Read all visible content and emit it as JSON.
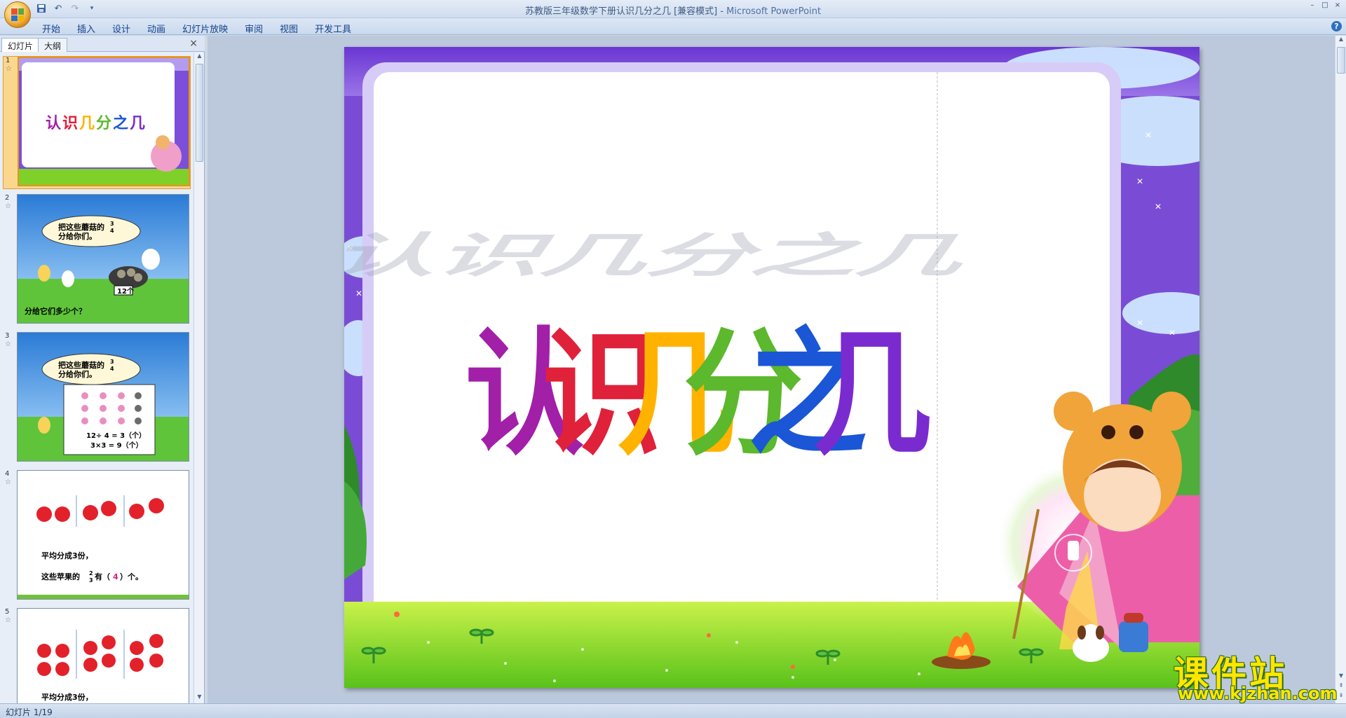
{
  "window": {
    "title": "苏教版三年级数学下册认识几分之几 [兼容模式] - ",
    "app_name": "Microsoft PowerPoint",
    "controls": [
      "–",
      "□",
      "×"
    ]
  },
  "quick_access": [
    "save-icon",
    "undo-icon",
    "redo-icon",
    "customize-icon"
  ],
  "ribbon": {
    "tabs": [
      "开始",
      "插入",
      "设计",
      "动画",
      "幻灯片放映",
      "审阅",
      "视图",
      "开发工具"
    ]
  },
  "left_panel": {
    "tabs": [
      "幻灯片",
      "大纲"
    ],
    "close": "×",
    "slides": [
      {
        "num": "1",
        "title": "认识几分之几"
      },
      {
        "num": "2",
        "bubble_line1": "把这些蘑菇的",
        "bubble_line2": "分给你们。",
        "frac_num": "3",
        "frac_den": "4",
        "count_label": "12个",
        "question": "分给它们多少个？"
      },
      {
        "num": "3",
        "bubble_line1": "把这些蘑菇的",
        "bubble_line2": "分给你们。",
        "frac_num": "3",
        "frac_den": "4",
        "calc1": "12÷ 4 = 3（个）",
        "calc2": "3×3 = 9（个）"
      },
      {
        "num": "4",
        "line1": "平均分成3份，",
        "line2_pre": "这些苹果的",
        "frac_num": "2",
        "frac_den": "3",
        "line2_post": "有（",
        "answer": "4",
        "line2_end": "）个。"
      },
      {
        "num": "5",
        "line1": "平均分成3份，"
      }
    ]
  },
  "slide_main": {
    "title_chars": [
      "认",
      "识",
      "几",
      "分",
      "之",
      "几"
    ],
    "title_colors": [
      "#a21fa8",
      "#e0213a",
      "#ffb300",
      "#5cb82c",
      "#1a56d6",
      "#7a2bd0"
    ]
  },
  "status": {
    "slide_indicator": "幻灯片 1/19"
  },
  "watermark": {
    "title": "课件站",
    "url": "www.kjzhan.com"
  }
}
